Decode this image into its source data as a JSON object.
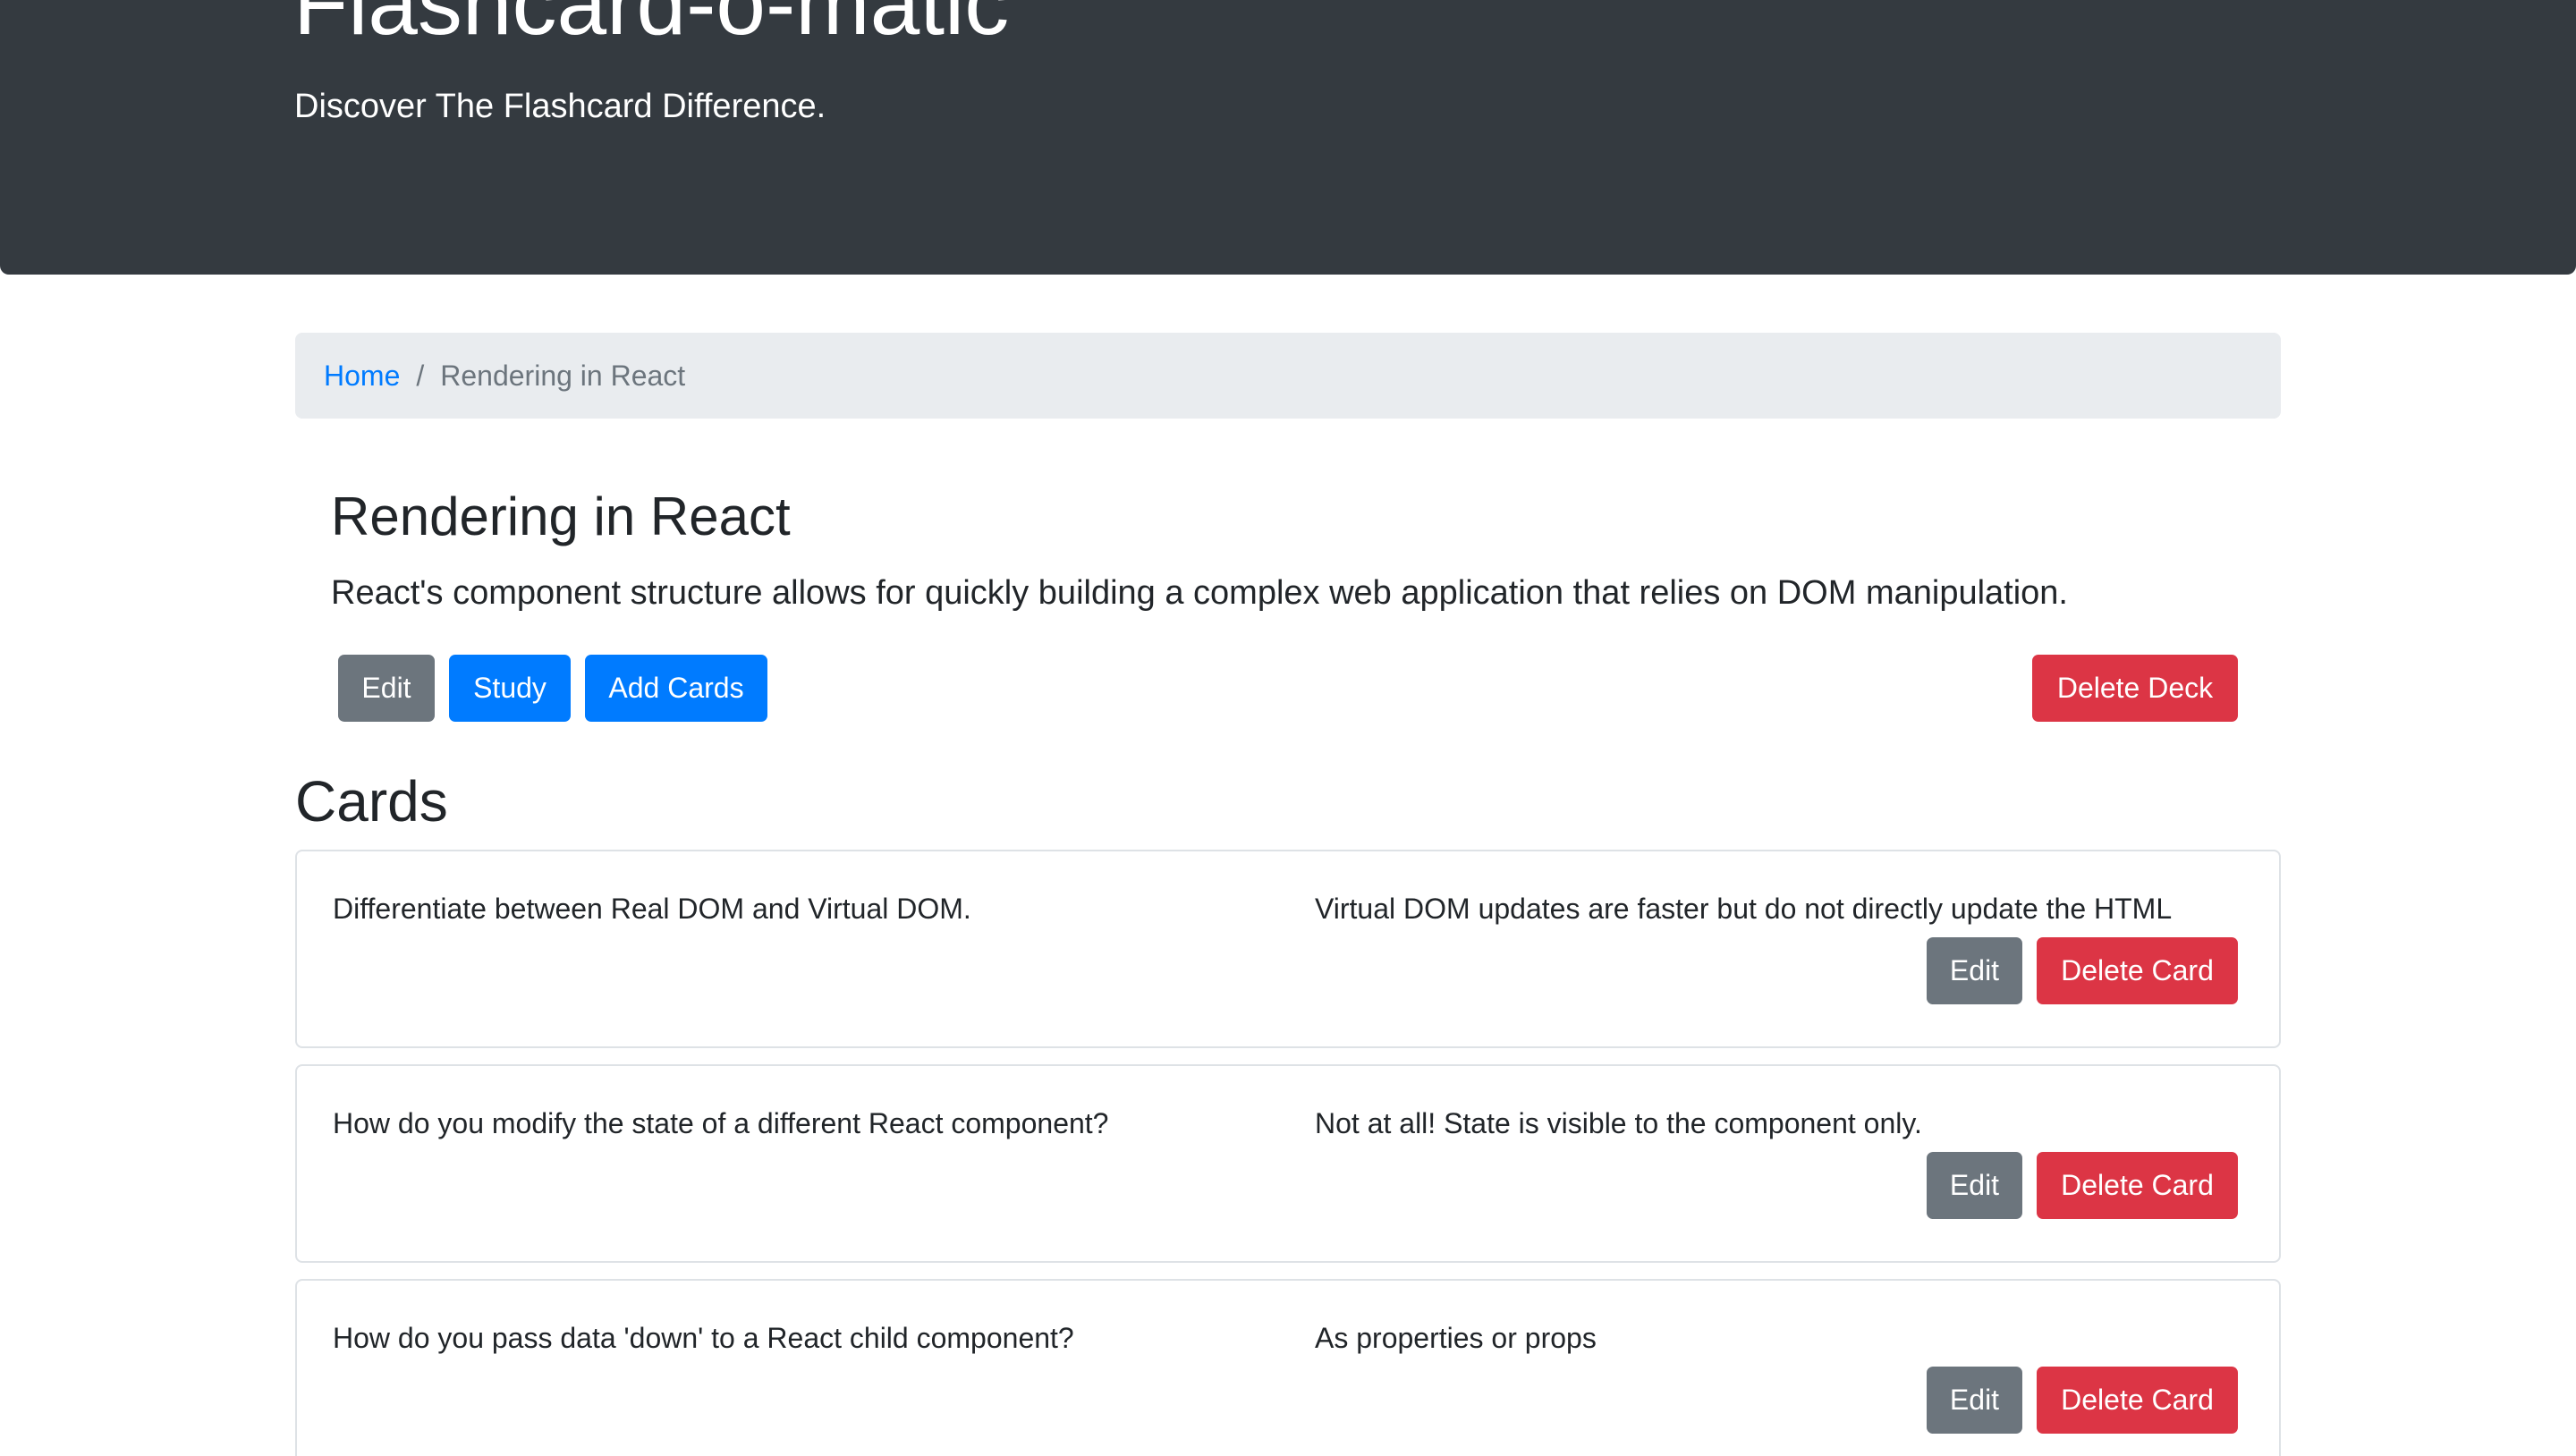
{
  "header": {
    "title": "Flashcard-o-matic",
    "tagline": "Discover The Flashcard Difference."
  },
  "breadcrumb": {
    "home": "Home",
    "separator": "/",
    "current": "Rendering in React"
  },
  "deck": {
    "name": "Rendering in React",
    "description": "React's component structure allows for quickly building a complex web application that relies on DOM manipulation.",
    "buttons": {
      "edit": "Edit",
      "study": "Study",
      "add_cards": "Add Cards",
      "delete_deck": "Delete Deck"
    }
  },
  "cards_section": {
    "heading": "Cards",
    "edit_label": "Edit",
    "delete_label": "Delete Card",
    "cards": [
      {
        "front": "Differentiate between Real DOM and Virtual DOM.",
        "back": "Virtual DOM updates are faster but do not directly update the HTML"
      },
      {
        "front": "How do you modify the state of a different React component?",
        "back": "Not at all! State is visible to the component only."
      },
      {
        "front": "How do you pass data 'down' to a React child component?",
        "back": "As properties or props"
      }
    ]
  },
  "colors": {
    "header_bg": "#343a40",
    "primary": "#007bff",
    "secondary": "#6c757d",
    "danger": "#dc3545",
    "breadcrumb_bg": "#e9ecef"
  }
}
